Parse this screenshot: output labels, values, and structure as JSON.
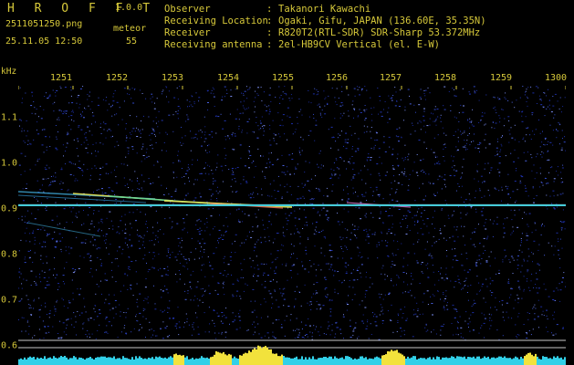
{
  "header": {
    "logo": "H R O F F T",
    "version": "1.0.0",
    "filename": "2511051250.png",
    "detection_label": "meteor",
    "datetime": "25.11.05 12:50",
    "count": "55"
  },
  "station": [
    {
      "label": "Observer",
      "sep": ":",
      "value": "Takanori Kawachi"
    },
    {
      "label": "Receiving Location",
      "sep": ":",
      "value": "Ogaki, Gifu, JAPAN (136.60E, 35.35N)"
    },
    {
      "label": "Receiver",
      "sep": ":",
      "value": "R820T2(RTL-SDR) SDR-Sharp 53.372MHz"
    },
    {
      "label": "Receiving antenna",
      "sep": ":",
      "value": "2el-HB9CV Vertical (el. E-W)"
    }
  ],
  "axes": {
    "y_unit": "kHz",
    "x_ticks": [
      "1251",
      "1252",
      "1253",
      "1254",
      "1255",
      "1256",
      "1257",
      "1258",
      "1259",
      "1300"
    ],
    "y_ticks": [
      "1.1",
      "1.0",
      "0.9",
      "0.8",
      "0.7",
      "0.6"
    ]
  },
  "colors": {
    "background": "#000000",
    "label": "#d6c83a",
    "noise": "#1c2fa8",
    "carrier": "#3fc9d6",
    "meteor": "#e8e85a",
    "level_bar": "#31d0e8",
    "level_peak": "#f2e23c",
    "ref_line": "#c8c8c8"
  }
}
